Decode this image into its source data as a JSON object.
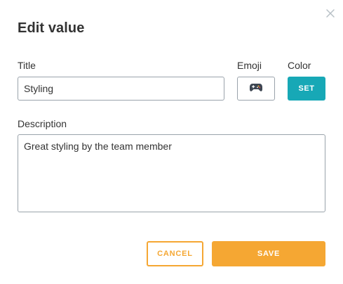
{
  "dialog": {
    "title": "Edit value",
    "close_icon": "close-icon"
  },
  "fields": {
    "title_label": "Title",
    "title_value": "Styling",
    "emoji_label": "Emoji",
    "emoji_icon": "game-controller-icon",
    "color_label": "Color",
    "color_button": "SET",
    "color_value": "#17a8b6",
    "description_label": "Description",
    "description_value": "Great styling by the team member"
  },
  "actions": {
    "cancel_label": "CANCEL",
    "save_label": "SAVE",
    "accent_color": "#f5a733"
  }
}
